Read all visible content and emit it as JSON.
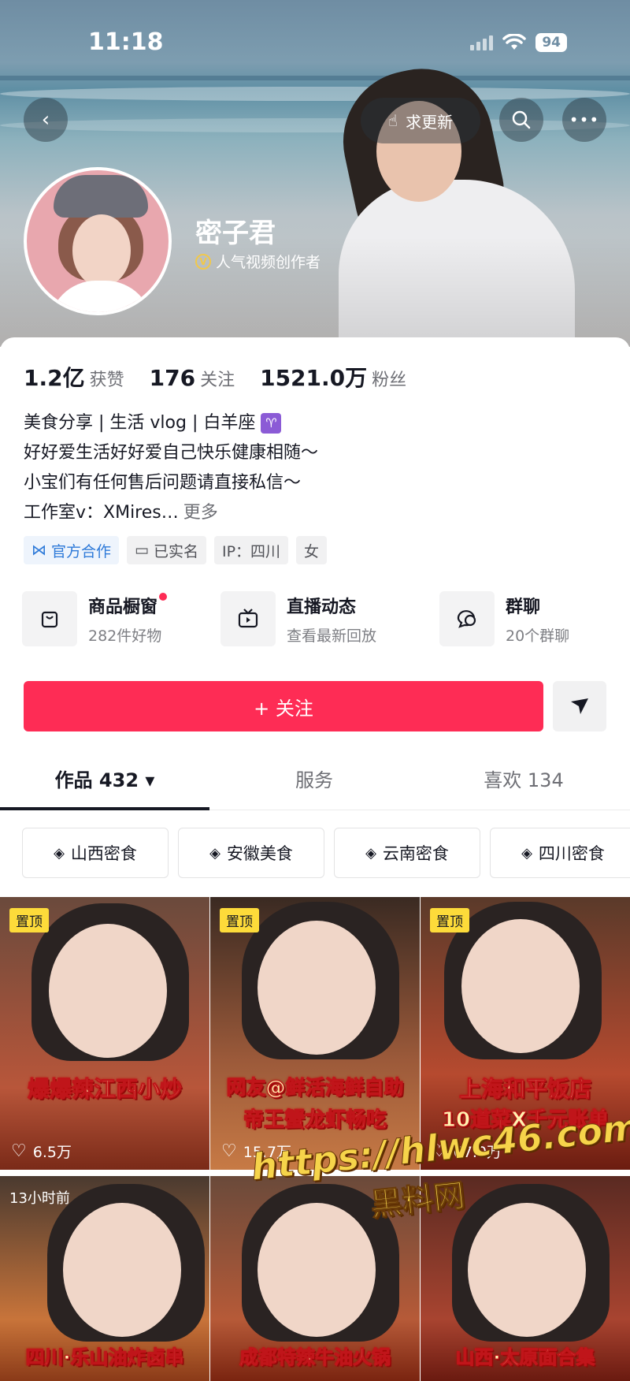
{
  "status_bar": {
    "time": "11:18",
    "battery": "94"
  },
  "header": {
    "request_update_label": "求更新"
  },
  "profile": {
    "name": "密子君",
    "badge": "人气视频创作者"
  },
  "stats": [
    {
      "num": "1.2亿",
      "label": "获赞"
    },
    {
      "num": "176",
      "label": "关注"
    },
    {
      "num": "1521.0万",
      "label": "粉丝"
    }
  ],
  "bio": {
    "line1": "美食分享 | 生活 vlog | 白羊座",
    "line1_emoji": "♈",
    "line2": "好好爱生活好好爱自己快乐健康相随～",
    "line3": "小宝们有任何售后问题请直接私信～",
    "line4": "工作室v：XMires…",
    "more": "更多"
  },
  "tags": [
    "官方合作",
    "已实名",
    "IP：四川",
    "女"
  ],
  "shortcuts": [
    {
      "title": "商品橱窗",
      "sub": "282件好物",
      "icon": "shopping-bag-icon"
    },
    {
      "title": "直播动态",
      "sub": "查看最新回放",
      "icon": "tv-icon"
    },
    {
      "title": "群聊",
      "sub": "20个群聊",
      "icon": "chat-icon"
    }
  ],
  "follow_label": "+ 关注",
  "tabs": [
    "作品 432 ▾",
    "服务",
    "喜欢 134"
  ],
  "collections": [
    "山西密食",
    "安徽美食",
    "云南密食",
    "四川密食"
  ],
  "videos": [
    {
      "badge": "置顶",
      "cap1": "爆爆辣江西小炒",
      "cap2": "",
      "likes": "6.5万"
    },
    {
      "badge": "置顶",
      "cap1": "网友@鲜活海鲜自助",
      "cap2": "帝王蟹龙虾畅吃",
      "likes": "15.7万"
    },
    {
      "badge": "置顶",
      "cap1": "上海和平饭店",
      "cap2": "10道菜X千元账单",
      "likes": "67.0万"
    },
    {
      "badge": "13小时前",
      "cap1": "四川·乐山油炸卤串",
      "cap2": "",
      "likes": ""
    },
    {
      "badge": "",
      "cap1": "成都特辣牛油火锅",
      "cap2": "",
      "likes": ""
    },
    {
      "badge": "",
      "cap1": "山西·太原面合集",
      "cap2": "",
      "likes": ""
    }
  ],
  "watermark": {
    "line1": "https://hlwc46.com",
    "line2": "黑料网"
  },
  "colors": {
    "accent": "#fe2c55",
    "pin": "#fddb3a",
    "official": "#2e7ad9"
  }
}
